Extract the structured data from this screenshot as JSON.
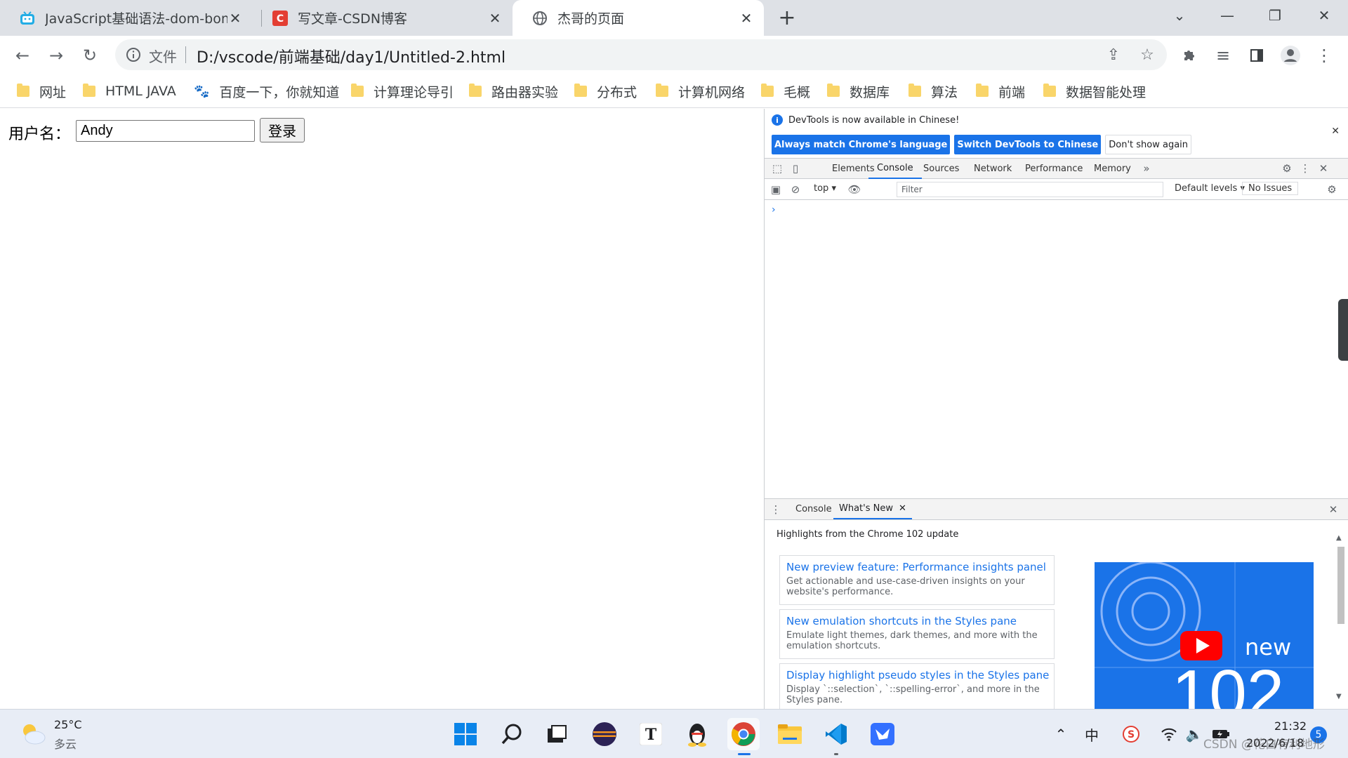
{
  "tabs": [
    {
      "title": "JavaScript基础语法-dom-bom-",
      "favicon": "bilibili-icon"
    },
    {
      "title": "写文章-CSDN博客",
      "favicon": "csdn-icon"
    },
    {
      "title": "杰哥的页面",
      "favicon": "globe-icon"
    }
  ],
  "omnibox": {
    "scheme": "文件",
    "url": "D:/vscode/前端基础/day1/Untitled-2.html"
  },
  "bookmarks": [
    "网址",
    "HTML JAVA",
    "百度一下，你就知道",
    "计算理论导引",
    "路由器实验",
    "分布式",
    "计算机网络",
    "毛概",
    "数据库",
    "算法",
    "前端",
    "数据智能处理"
  ],
  "page": {
    "username_label": "用户名：",
    "username_value": "Andy",
    "login_label": "登录"
  },
  "devtools": {
    "info_text": "DevTools is now available in Chinese!",
    "btn_match": "Always match Chrome's language",
    "btn_switch": "Switch DevTools to Chinese",
    "btn_dont_show": "Don't show again",
    "tabs": [
      "Elements",
      "Console",
      "Sources",
      "Network",
      "Performance",
      "Memory"
    ],
    "context": "top",
    "filter_placeholder": "Filter",
    "levels": "Default levels",
    "issues": "No Issues",
    "prompt": "›",
    "drawer_tabs": [
      "Console",
      "What's New"
    ],
    "highlights": "Highlights from the Chrome 102 update",
    "whats_new": [
      {
        "title": "New preview feature: Performance insights panel",
        "desc": "Get actionable and use-case-driven insights on your website's performance."
      },
      {
        "title": "New emulation shortcuts in the Styles pane",
        "desc": "Emulate light themes, dark themes, and more with the emulation shortcuts."
      },
      {
        "title": "Display highlight pseudo styles in the Styles pane",
        "desc": "Display `::selection`, `::spelling-error`, and more in the Styles pane."
      }
    ],
    "thumb_new": "new",
    "thumb_num": "102"
  },
  "taskbar": {
    "weather_temp": "25°C",
    "weather_desc": "多云",
    "time": "21:32",
    "date": "2022/6/18",
    "notifications": "5",
    "ime": "中"
  },
  "watermark": "CSDN @花白有利地形",
  "colors": {
    "accent": "#1a73e8",
    "tabstrip": "#dee1e6",
    "folder": "#f9d56a"
  }
}
